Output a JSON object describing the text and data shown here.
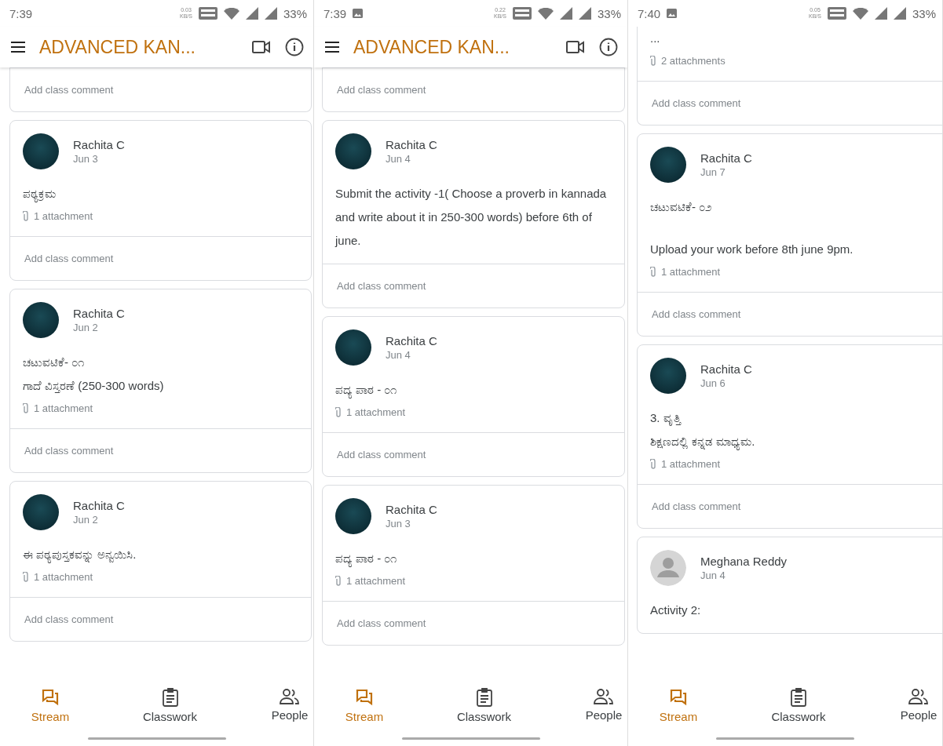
{
  "panels": [
    {
      "status_bar": {
        "time": "7:39",
        "image_notification": false,
        "net_speed": "0.03",
        "net_unit": "KB/S",
        "battery": "33%"
      },
      "app_bar": {
        "title": "ADVANCED KAN..."
      },
      "posts": [
        {
          "kind": "partial",
          "comment_placeholder": "Add class comment"
        },
        {
          "kind": "post",
          "author": "Rachita C",
          "date": "Jun 3",
          "default_avatar": false,
          "paragraphs": [
            [
              "ಪಠ್ಯಕ್ರಮ"
            ]
          ],
          "attachments": "1 attachment",
          "comment_placeholder": "Add class comment"
        },
        {
          "kind": "post",
          "author": "Rachita C",
          "date": "Jun 2",
          "default_avatar": false,
          "paragraphs": [
            [
              "ಚಟುವಟಿಕೆ- ೦೧",
              "ಗಾದೆ ವಿಸ್ತರಣೆ (250-300 words)"
            ]
          ],
          "attachments": "1 attachment",
          "comment_placeholder": "Add class comment"
        },
        {
          "kind": "post",
          "author": "Rachita C",
          "date": "Jun 2",
          "default_avatar": false,
          "paragraphs": [
            [
              "ಈ ಪಠ್ಯಪುಸ್ತಕವನ್ನು ಅನ್ವಯಿಸಿ."
            ]
          ],
          "attachments": "1 attachment",
          "comment_placeholder": "Add class comment"
        }
      ],
      "bottom_nav": [
        {
          "label": "Stream",
          "selected": true
        },
        {
          "label": "Classwork",
          "selected": false
        },
        {
          "label": "People",
          "selected": false
        }
      ]
    },
    {
      "status_bar": {
        "time": "7:39",
        "image_notification": true,
        "net_speed": "0.22",
        "net_unit": "KB/S",
        "battery": "33%"
      },
      "app_bar": {
        "title": "ADVANCED KAN..."
      },
      "posts": [
        {
          "kind": "partial",
          "comment_placeholder": "Add class comment"
        },
        {
          "kind": "post",
          "author": "Rachita C",
          "date": "Jun 4",
          "default_avatar": false,
          "paragraphs": [
            [
              "Submit the activity -1( Choose a proverb in kannada and write about it in 250-300 words)  before 6th of june."
            ]
          ],
          "comment_placeholder": "Add class comment"
        },
        {
          "kind": "post",
          "author": "Rachita C",
          "date": "Jun 4",
          "default_avatar": false,
          "paragraphs": [
            [
              "ಪದ್ಯ ಪಾಠ - ೦೧"
            ]
          ],
          "attachments": "1 attachment",
          "comment_placeholder": "Add class comment"
        },
        {
          "kind": "post",
          "author": "Rachita C",
          "date": "Jun 3",
          "default_avatar": false,
          "paragraphs": [
            [
              "ಪದ್ಯ ಪಾಠ - ೦೧"
            ]
          ],
          "attachments": "1 attachment",
          "comment_placeholder": "Add class comment"
        }
      ],
      "bottom_nav": [
        {
          "label": "Stream",
          "selected": true
        },
        {
          "label": "Classwork",
          "selected": false
        },
        {
          "label": "People",
          "selected": false
        }
      ]
    },
    {
      "status_bar": {
        "time": "7:40",
        "image_notification": true,
        "net_speed": "0.05",
        "net_unit": "KB/S",
        "battery": "33%"
      },
      "posts": [
        {
          "kind": "partial",
          "paragraphs": [
            [
              "..."
            ]
          ],
          "attachments": "2 attachments",
          "comment_placeholder": "Add class comment"
        },
        {
          "kind": "post",
          "author": "Rachita C",
          "date": "Jun 7",
          "default_avatar": false,
          "paragraphs": [
            [
              "ಚಟುವಟಿಕೆ- ೦೨"
            ],
            [
              "Upload your work before 8th june 9pm."
            ]
          ],
          "attachments": "1 attachment",
          "comment_placeholder": "Add class comment"
        },
        {
          "kind": "post",
          "author": "Rachita C",
          "date": "Jun 6",
          "default_avatar": false,
          "paragraphs": [
            [
              "3. ವೃತ್ತಿ",
              "ಶಿಕ್ಷಣದಲ್ಲಿ ಕನ್ನಡ ಮಾಧ್ಯಮ."
            ]
          ],
          "attachments": "1 attachment",
          "comment_placeholder": "Add class comment"
        },
        {
          "kind": "post",
          "author": "Meghana Reddy",
          "date": "Jun 4",
          "default_avatar": true,
          "paragraphs": [
            [
              "Activity 2:"
            ]
          ]
        }
      ],
      "bottom_nav": [
        {
          "label": "Stream",
          "selected": true
        },
        {
          "label": "Classwork",
          "selected": false
        },
        {
          "label": "People",
          "selected": false
        }
      ]
    }
  ]
}
